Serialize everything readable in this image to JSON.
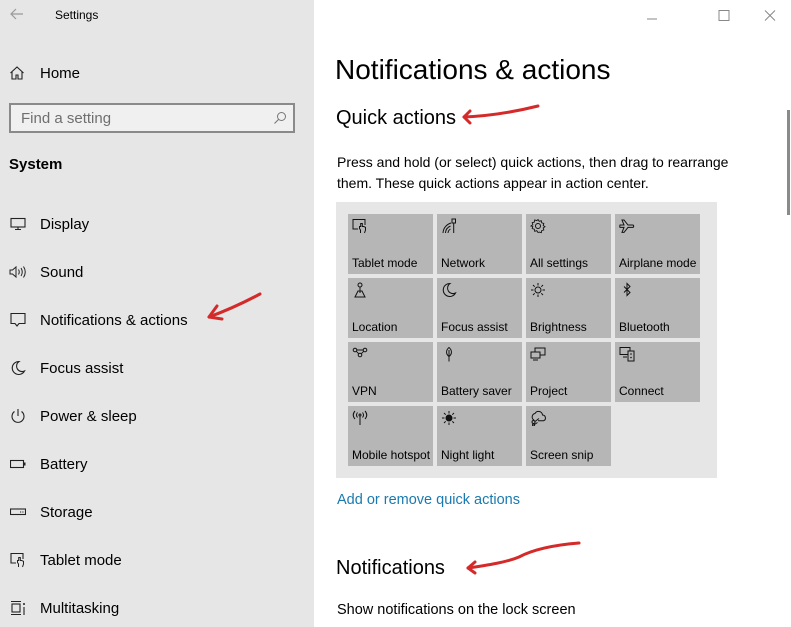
{
  "window": {
    "title": "Settings",
    "controls": {
      "minimize": "minimize",
      "maximize": "maximize",
      "close": "close"
    }
  },
  "sidebar": {
    "home_label": "Home",
    "search": {
      "placeholder": "Find a setting",
      "value": ""
    },
    "section_title": "System",
    "items": [
      {
        "label": "Display",
        "icon": "display-icon"
      },
      {
        "label": "Sound",
        "icon": "sound-icon"
      },
      {
        "label": "Notifications & actions",
        "icon": "notifications-icon"
      },
      {
        "label": "Focus assist",
        "icon": "moon-icon"
      },
      {
        "label": "Power & sleep",
        "icon": "power-icon"
      },
      {
        "label": "Battery",
        "icon": "battery-icon"
      },
      {
        "label": "Storage",
        "icon": "storage-icon"
      },
      {
        "label": "Tablet mode",
        "icon": "tablet-mode-icon"
      },
      {
        "label": "Multitasking",
        "icon": "multitasking-icon"
      }
    ]
  },
  "main": {
    "page_title": "Notifications & actions",
    "quick_actions": {
      "heading": "Quick actions",
      "description": "Press and hold (or select) quick actions, then drag to rearrange them. These quick actions appear in action center.",
      "tiles": [
        {
          "label": "Tablet mode",
          "icon": "tablet-mode-icon"
        },
        {
          "label": "Network",
          "icon": "network-icon"
        },
        {
          "label": "All settings",
          "icon": "gear-icon"
        },
        {
          "label": "Airplane mode",
          "icon": "airplane-icon"
        },
        {
          "label": "Location",
          "icon": "location-icon"
        },
        {
          "label": "Focus assist",
          "icon": "moon-icon"
        },
        {
          "label": "Brightness",
          "icon": "brightness-icon"
        },
        {
          "label": "Bluetooth",
          "icon": "bluetooth-icon"
        },
        {
          "label": "VPN",
          "icon": "vpn-icon"
        },
        {
          "label": "Battery saver",
          "icon": "battery-saver-icon"
        },
        {
          "label": "Project",
          "icon": "project-icon"
        },
        {
          "label": "Connect",
          "icon": "connect-icon"
        },
        {
          "label": "Mobile hotspot",
          "icon": "mobile-hotspot-icon"
        },
        {
          "label": "Night light",
          "icon": "night-light-icon"
        },
        {
          "label": "Screen snip",
          "icon": "screen-snip-icon"
        }
      ],
      "link": "Add or remove quick actions"
    },
    "notifications": {
      "heading": "Notifications",
      "lock_screen_label": "Show notifications on the lock screen"
    }
  },
  "colors": {
    "sidebar_bg": "#e6e6e6",
    "tile_bg": "#b6b6b6",
    "link": "#1a7ab0",
    "annotation": "#d42a2a"
  }
}
